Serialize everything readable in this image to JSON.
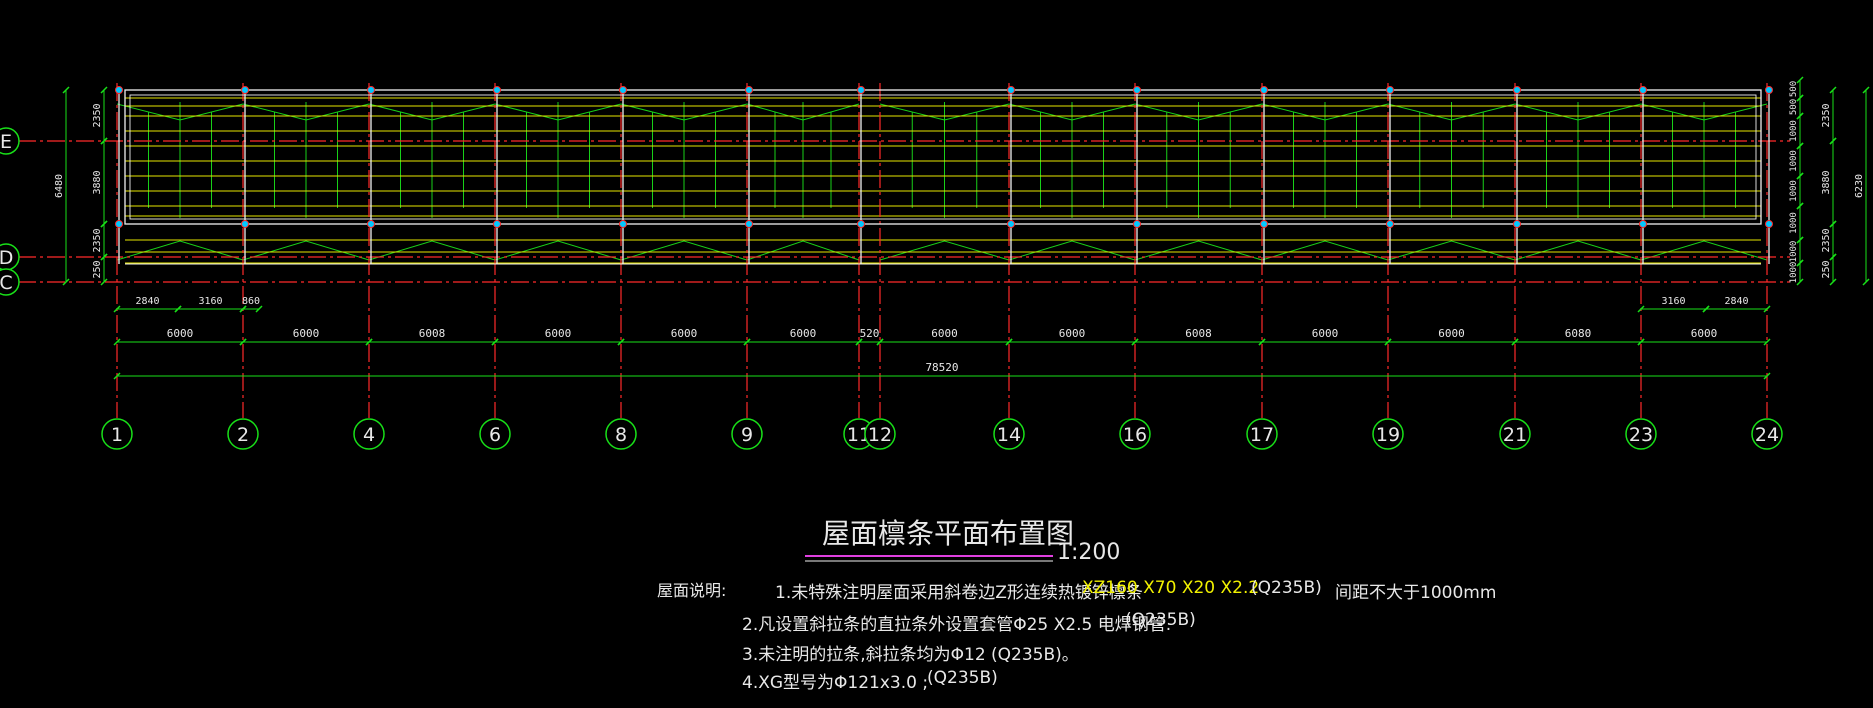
{
  "drawing": {
    "title": "屋面檩条平面布置图",
    "scale": "1:200",
    "colors": {
      "background": "#000000",
      "axis": "#ff2a2a",
      "dimension": "#18e018",
      "purlin": "#e6e600",
      "beam": "#f0f0f0",
      "bracing": "#18d018",
      "column": "#00c8ff",
      "note_spec": "#f2f200",
      "text": "#e8e8e8"
    },
    "grid_axes_x": [
      "1",
      "2",
      "4",
      "6",
      "8",
      "9",
      "11",
      "12",
      "14",
      "16",
      "17",
      "19",
      "21",
      "23",
      "24"
    ],
    "grid_axes_y": [
      "E",
      "D",
      "C"
    ],
    "dims_top_row": [
      "6000",
      "6000",
      "6008",
      "6000",
      "6000",
      "6000",
      "520",
      "6000",
      "6000",
      "6008",
      "6000",
      "6000",
      "6080",
      "6000"
    ],
    "total_length": "78520",
    "dims_bottom_left": [
      "2840",
      "3160",
      "860"
    ],
    "dims_bottom_right": [
      "3160",
      "2840"
    ],
    "dims_left": [
      "2350",
      "3880",
      "2350",
      "250"
    ],
    "dim_left_total": "6480",
    "dims_right_outer": [
      "2350",
      "3880",
      "2350",
      "250"
    ],
    "dim_right_total": "6230",
    "dims_right_inner": [
      "500",
      "500",
      "1000",
      "1000",
      "1000",
      "1000",
      "1000",
      "1000"
    ]
  },
  "notes": {
    "heading": "屋面说明:",
    "line1": "1.未特殊注明屋面采用斜卷边Z形连续热镀锌檩条",
    "line1_spec": "XZ160 X70 X20 X2.2",
    "line1_grade": "(Q235B)",
    "line1_spacing": "间距不大于1000mm",
    "line2": "2.凡设置斜拉条的直拉条外设置套管Φ25 X2.5 电焊钢管.",
    "line2_grade": "(Q235B)",
    "line3": "3.未注明的拉条,斜拉条均为Φ12 (Q235B)。",
    "line4": "4.XG型号为Φ121x3.0 ;",
    "line4_grade": "(Q235B)"
  }
}
